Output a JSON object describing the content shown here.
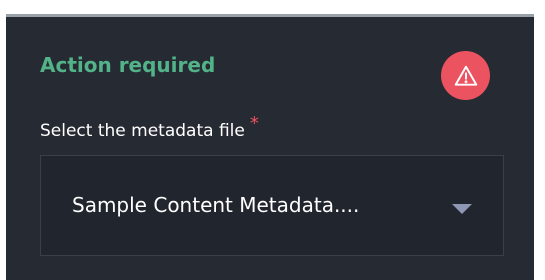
{
  "panel": {
    "title": "Action required",
    "alert_icon": "alert-triangle-icon"
  },
  "metadata_field": {
    "label": "Select the metadata file",
    "required_mark": "*",
    "selected_value": "Sample Content Metadata....",
    "caret_icon": "caret-down-icon"
  },
  "colors": {
    "background": "#262a33",
    "title": "#52b389",
    "alert": "#ec5361",
    "caret": "#8e97b3"
  }
}
